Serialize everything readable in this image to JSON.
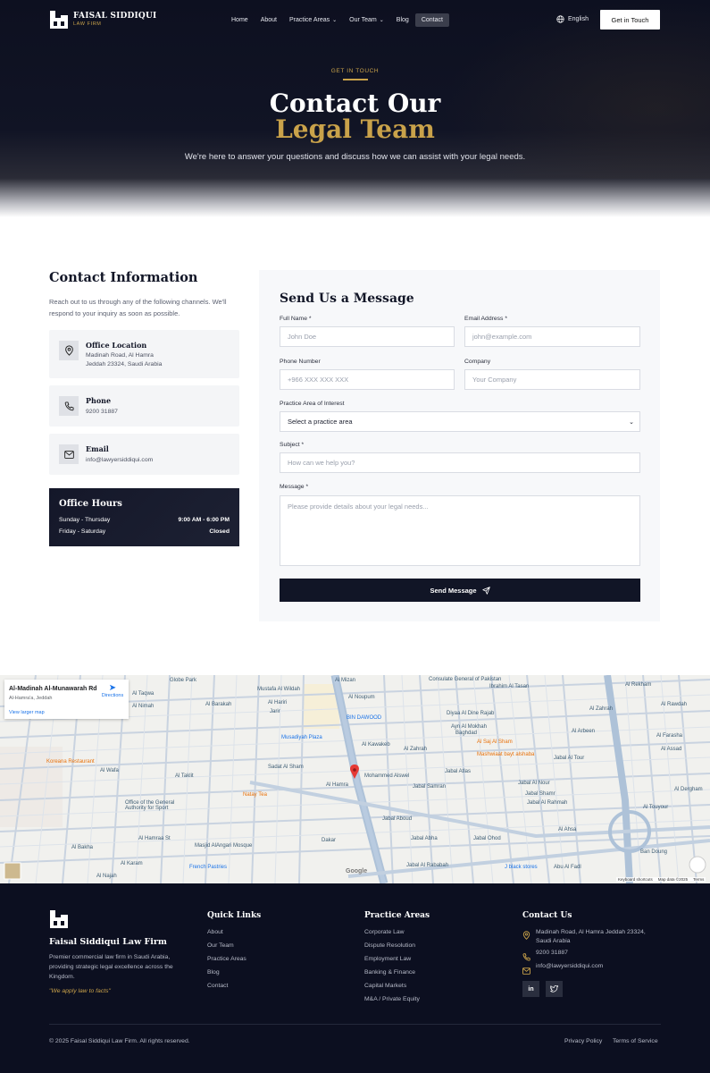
{
  "nav": {
    "brand_name": "FAISAL SIDDIQUI",
    "brand_sub": "LAW FIRM",
    "items": [
      {
        "label": "Home"
      },
      {
        "label": "About"
      },
      {
        "label": "Practice Areas"
      },
      {
        "label": "Our Team"
      },
      {
        "label": "Blog"
      },
      {
        "label": "Contact"
      }
    ],
    "language": "English",
    "cta": "Get in Touch"
  },
  "hero": {
    "kicker": "GET IN TOUCH",
    "title_line1": "Contact Our",
    "title_line2": "Legal Team",
    "subtitle": "We're here to answer your questions and discuss how we can assist with your legal needs."
  },
  "contact_info": {
    "title": "Contact Information",
    "description": "Reach out to us through any of the following channels. We'll respond to your inquiry as soon as possible.",
    "location": {
      "title": "Office Location",
      "line1": "Madinah Road, Al Hamra",
      "line2": "Jeddah 23324, Saudi Arabia",
      "icon": "map-pin-icon"
    },
    "phone": {
      "title": "Phone",
      "value": "9200 31887",
      "icon": "phone-icon"
    },
    "email": {
      "title": "Email",
      "value": "info@lawyersiddiqui.com",
      "icon": "mail-icon"
    },
    "hours": {
      "title": "Office Hours",
      "rows": [
        {
          "days": "Sunday - Thursday",
          "time": "9:00 AM - 6:00 PM"
        },
        {
          "days": "Friday - Saturday",
          "time": "Closed"
        }
      ]
    }
  },
  "form": {
    "title": "Send Us a Message",
    "full_name": {
      "label": "Full Name *",
      "placeholder": "John Doe"
    },
    "email": {
      "label": "Email Address *",
      "placeholder": "john@example.com"
    },
    "phone": {
      "label": "Phone Number",
      "placeholder": "+966 XXX XXX XXX"
    },
    "company": {
      "label": "Company",
      "placeholder": "Your Company"
    },
    "practice": {
      "label": "Practice Area of Interest",
      "value": "Select a practice area"
    },
    "subject": {
      "label": "Subject *",
      "placeholder": "How can we help you?"
    },
    "message": {
      "label": "Message *",
      "placeholder": "Please provide details about your legal needs..."
    },
    "submit": "Send Message"
  },
  "map": {
    "place_name": "Al-Madinah Al-Munawarah Rd",
    "place_sub": "Al-Hamra'a, Jeddah",
    "directions": "Directions",
    "larger_map": "View larger map",
    "attribution": [
      "Keyboard shortcuts",
      "Map data ©2025",
      "Terms"
    ],
    "google": "Google",
    "labels": [
      "Al Mizan",
      "Consulate General of Pakistan",
      "Ibrahim Al Tasan",
      "Al Rekham",
      "Mustafa Al Wildah",
      "Al Noupum",
      "Al Hariri",
      "Jarir",
      "BIN DAWOOD",
      "Musadiyah Plaza",
      "Al Kawakeb",
      "Al Zahrah",
      "Al Saj Al Sham",
      "Mashwiaat bayt alshaba",
      "Mohammed Alswel",
      "Jabal Samran",
      "Al Hamra",
      "Natay Tea",
      "Koreana Restaurant",
      "Office of the General Authority for Sport",
      "Masjid AlAngari Mosque",
      "French Pastries",
      "Jabal Aboud",
      "Jabal Ohod",
      "Jabal Abha",
      "Jabal Al Rahmah",
      "Jabal Al Tour",
      "Al Assad",
      "Al Farasha",
      "Al Dergham",
      "Al Touyour",
      "Ban Doung",
      "Globe Park",
      "Al Taqwa",
      "Al Nimah",
      "Al Wafa",
      "Al Taklit",
      "Al Bakha",
      "Al Karam",
      "Al Najah",
      "Al Hamraa St",
      "Jabal Al Rababah",
      "Abu Al Fadl",
      "Jabal Atlas",
      "Jabal Al Nour",
      "Al Ahsa",
      "Jabal Shamr",
      "Baghdad",
      "Al Zahrah",
      "Diyaa Al Dine Rajab",
      "Ayn Al Mokhah",
      "Sadat Al Sham",
      "Al Barakah",
      "Al Rawdah",
      "J black stores",
      "Dakar",
      "Al Arbeen"
    ]
  },
  "footer": {
    "brand": "Faisal Siddiqui Law Firm",
    "about": "Premier commercial law firm in Saudi Arabia, providing strategic legal excellence across the Kingdom.",
    "motto": "\"We apply law to facts\"",
    "quick_title": "Quick Links",
    "quick_links": [
      "About",
      "Our Team",
      "Practice Areas",
      "Blog",
      "Contact"
    ],
    "practice_title": "Practice Areas",
    "practice_links": [
      "Corporate Law",
      "Dispute Resolution",
      "Employment Law",
      "Banking & Finance",
      "Capital Markets",
      "M&A / Private Equity"
    ],
    "contact_title": "Contact Us",
    "address": "Madinah Road, Al Hamra Jeddah 23324, Saudi Arabia",
    "phone": "9200 31887",
    "email": "info@lawyersiddiqui.com",
    "social": [
      "linkedin-icon",
      "twitter-icon"
    ],
    "copyright": "© 2025 Faisal Siddiqui Law Firm. All rights reserved.",
    "privacy": "Privacy Policy",
    "terms": "Terms of Service"
  },
  "colors": {
    "navy": "#0c0f20",
    "gold": "#c9a24a",
    "panel": "#f4f5f7"
  }
}
